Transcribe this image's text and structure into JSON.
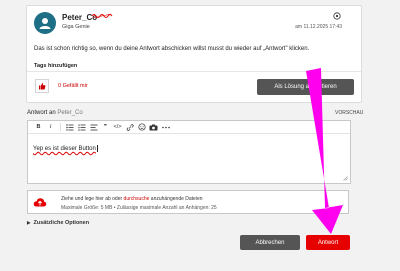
{
  "post": {
    "username": "Peter_Co",
    "rank": "Giga Genie",
    "timestamp": "am 11.12.2025 17:43",
    "body": "Das ist schon richtig so, wenn du deine Antwort abschicken willst musst du wieder auf „Antwort\" klicken.",
    "tags_label": "Tags hinzufügen",
    "like_count": "0 Gefällt mir",
    "solution_button": "Als Lösung akzeptieren"
  },
  "reply": {
    "label": "Antwort an",
    "recipient": "Peter_Co",
    "preview_label": "VORSCHAU"
  },
  "toolbar": {
    "bold": "B",
    "italic": "I",
    "quote": "❞",
    "code": "</>"
  },
  "editor": {
    "content": "Yep es ist dieser Button"
  },
  "upload": {
    "text_before": "Ziehe und lege hier ab oder",
    "link": "durchsuche",
    "text_after": "anzuhängende Dateien",
    "limits": "Maximale Größe: 5 MB • Zulässige maximale Anzahl an Anhängen: 25"
  },
  "extra_options": "Zusätzliche Optionen",
  "actions": {
    "cancel": "Abbrechen",
    "submit": "Antwort"
  },
  "colors": {
    "accent": "#e60000",
    "annotation": "#ff00ee",
    "avatar": "#1d6f86"
  }
}
